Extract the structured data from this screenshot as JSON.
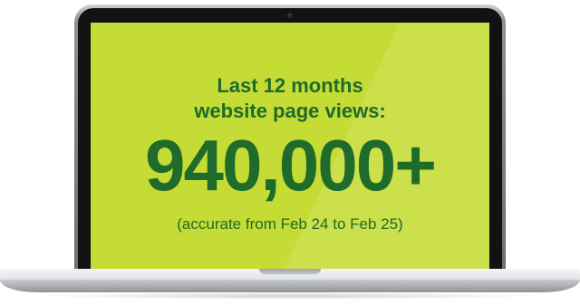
{
  "screen": {
    "headline_line1": "Last 12 months",
    "headline_line2": "website page views:",
    "big_number": "940,000+",
    "note": "(accurate from Feb 24 to Feb 25)"
  },
  "colors": {
    "screen_background": "#c5dc36",
    "text": "#1e6b2b",
    "bezel": "#111214"
  },
  "icons": {
    "camera": "camera-icon"
  }
}
